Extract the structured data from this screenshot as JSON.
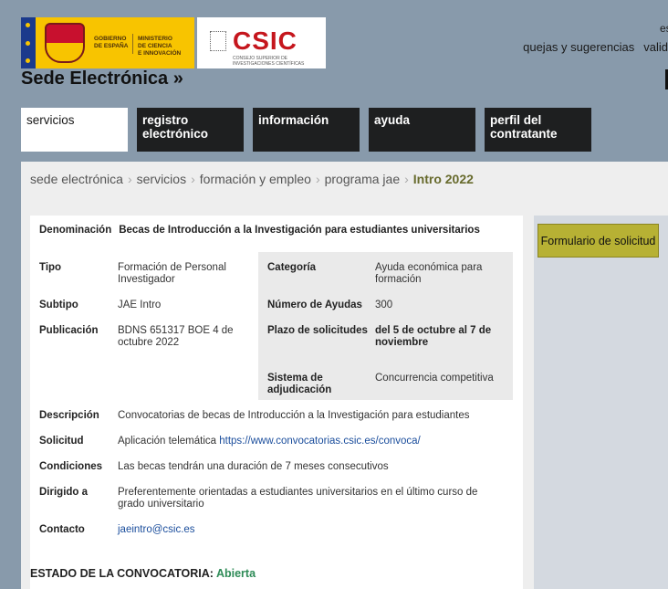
{
  "header": {
    "gobierno_text": "GOBIERNO\nDE ESPAÑA",
    "ministerio_text": "MINISTERIO\nDE CIENCIA\nE INNOVACIÓN",
    "csic_name": "CSIC",
    "csic_subtitle": "CONSEJO SUPERIOR DE INVESTIGACIONES CIENTÍFICAS",
    "site_title": "Sede Electrónica »",
    "top_links": [
      "quejas y sugerencias",
      "valid"
    ],
    "lang_fragment": "es"
  },
  "nav": {
    "tabs": [
      {
        "label": "servicios"
      },
      {
        "label": "registro electrónico"
      },
      {
        "label": "información"
      },
      {
        "label": "ayuda"
      },
      {
        "label": "perfil del contratante"
      }
    ]
  },
  "breadcrumb": {
    "items": [
      "sede electrónica",
      "servicios",
      "formación y empleo",
      "programa jae"
    ],
    "current": "Intro 2022",
    "separator": "›"
  },
  "sidebar": {
    "form_button": "Formulario de solicitud"
  },
  "details": {
    "denominacion_label": "Denominación",
    "denominacion_value": "Becas de Introducción a la Investigación para estudiantes universitarios",
    "tipo_label": "Tipo",
    "tipo_value": "Formación de Personal Investigador",
    "subtipo_label": "Subtipo",
    "subtipo_value": "JAE Intro",
    "publicacion_label": "Publicación",
    "publicacion_value": "BDNS 651317 BOE 4 de octubre 2022",
    "categoria_label": "Categoría",
    "categoria_value": "Ayuda económica para formación",
    "numero_label": "Número de Ayudas",
    "numero_value": "300",
    "plazo_label": "Plazo de solicitudes",
    "plazo_value": "del 5 de octubre al 7 de noviembre",
    "sistema_label": "Sistema de adjudicación",
    "sistema_value": "Concurrencia competitiva",
    "descripcion_label": "Descripción",
    "descripcion_value": "Convocatorias de becas de Introducción a la Investigación para estudiantes",
    "solicitud_label": "Solicitud",
    "solicitud_value": "Aplicación telemática",
    "solicitud_link": "https://www.convocatorias.csic.es/convoca/",
    "condiciones_label": "Condiciones",
    "condiciones_value": "Las becas tendrán una duración de 7 meses consecutivos",
    "dirigido_label": "Dirigido a",
    "dirigido_value": "Preferentemente orientadas a estudiantes universitarios en el último curso de grado universitario",
    "contacto_label": "Contacto",
    "contacto_email": "jaeintro@csic.es"
  },
  "status": {
    "label": "ESTADO DE LA CONVOCATORIA",
    "colon": ":",
    "value": "Abierta"
  },
  "colors": {
    "background": "#889aab",
    "tab_dark": "#1e1f20",
    "button_olive": "#b7b134",
    "breadcrumb_current": "#676a2c",
    "status_open": "#2e8b57",
    "link": "#1a4d9c"
  }
}
